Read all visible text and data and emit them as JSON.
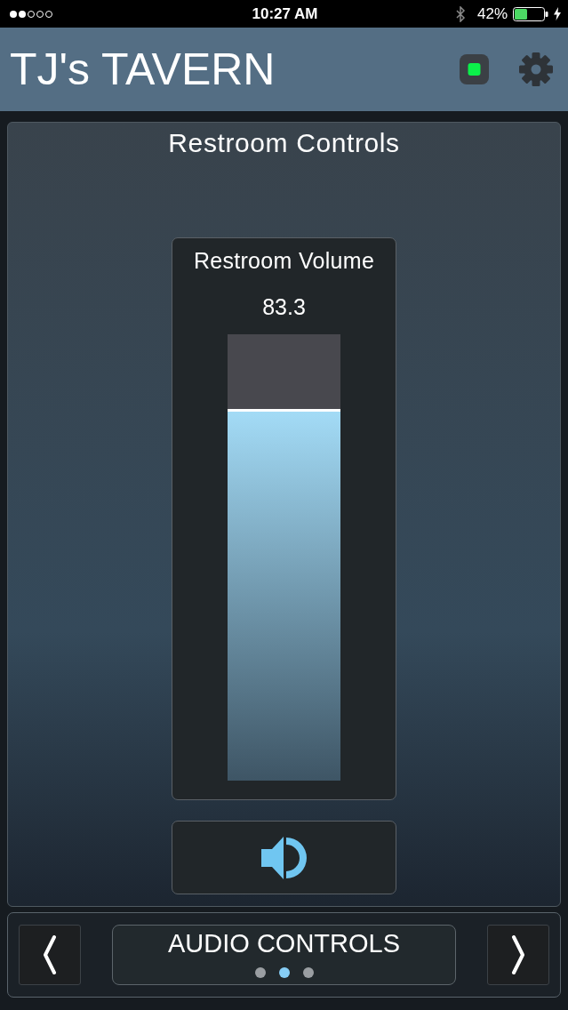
{
  "status_bar": {
    "time": "10:27 AM",
    "battery_percent": "42%",
    "charging": true
  },
  "header": {
    "title": "TJ's TAVERN",
    "connected": true
  },
  "panel": {
    "title": "Restroom Controls",
    "volume": {
      "label": "Restroom Volume",
      "reading": "83.3",
      "level": 0.833
    },
    "mute_button": {
      "muted": false
    }
  },
  "navigation": {
    "label": "AUDIO CONTROLS",
    "pages": [
      {
        "selected": false
      },
      {
        "selected": true
      },
      {
        "selected": false
      }
    ]
  }
}
